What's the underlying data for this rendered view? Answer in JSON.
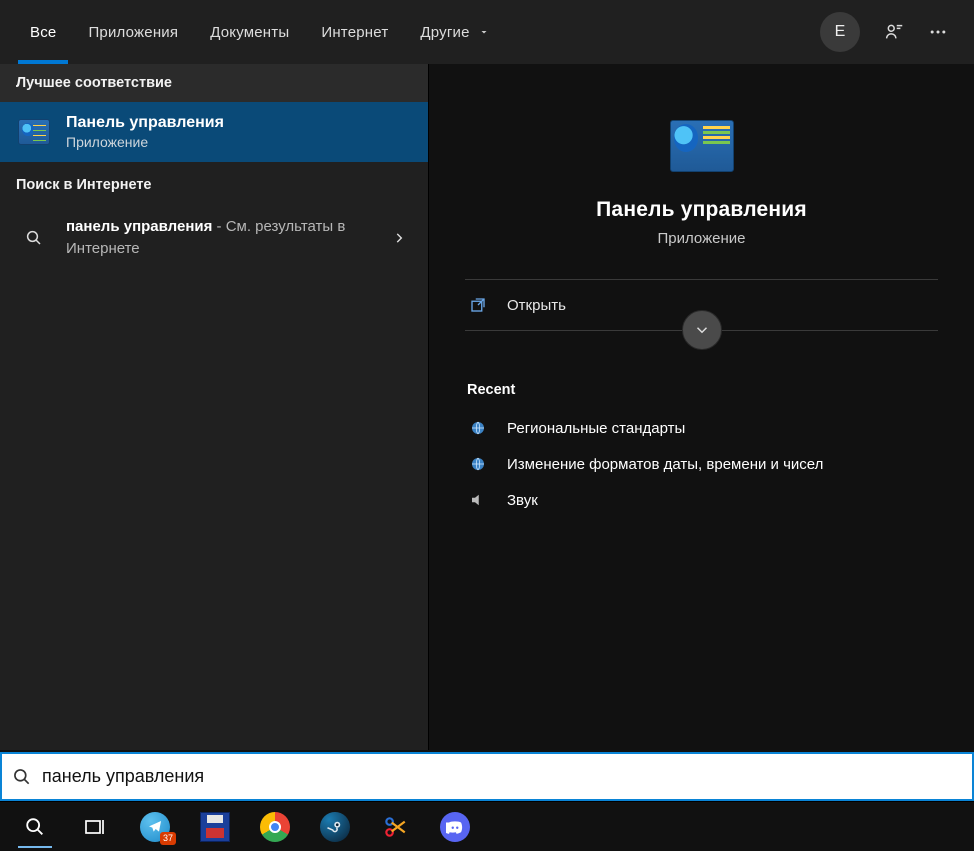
{
  "tabs": {
    "all": "Все",
    "apps": "Приложения",
    "docs": "Документы",
    "web": "Интернет",
    "more": "Другие"
  },
  "user_initial": "E",
  "left": {
    "best_match_header": "Лучшее соответствие",
    "best_match": {
      "title": "Панель управления",
      "subtitle": "Приложение"
    },
    "web_header": "Поиск в Интернете",
    "web_result": {
      "query": "панель управления",
      "desc": " - См. результаты в Интернете"
    }
  },
  "right": {
    "title": "Панель управления",
    "subtitle": "Приложение",
    "open": "Открыть",
    "recent_header": "Recent",
    "recent": [
      "Региональные стандарты",
      "Изменение форматов даты, времени и чисел",
      "Звук"
    ]
  },
  "search_value": "панель управления",
  "taskbar": {
    "telegram_badge": "37"
  }
}
